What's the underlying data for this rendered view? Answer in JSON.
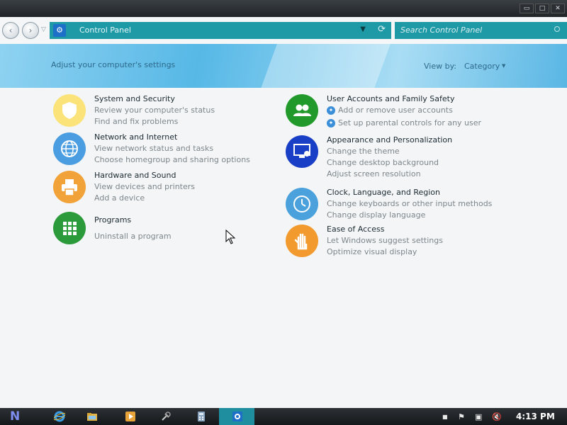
{
  "window": {
    "buttons": {
      "minimize": "▭",
      "maximize": "□",
      "close": "✕"
    }
  },
  "address": {
    "nav": {
      "back": "‹",
      "forward": "›",
      "dropdown": "▽"
    },
    "path": "Control Panel",
    "dropdown_glyph": "▼",
    "refresh_glyph": "⟳",
    "search_placeholder": "Search Control Panel"
  },
  "banner": {
    "heading": "Adjust your computer's settings",
    "view_by_label": "View by:",
    "view_by_value": "Category",
    "view_by_arrow": "▼"
  },
  "categories": [
    {
      "title": "System and Security",
      "links": [
        "Review your computer's status",
        "Find and fix problems"
      ],
      "icon": "shield-icon",
      "color": "#fbe37a"
    },
    {
      "title": "Network and Internet",
      "links": [
        "View network status and tasks",
        "Choose homegroup and sharing options"
      ],
      "icon": "globe-icon",
      "color": "#4a9de0"
    },
    {
      "title": "Hardware and Sound",
      "links": [
        "View devices and printers",
        "Add a device"
      ],
      "icon": "printer-icon",
      "color": "#f1a238"
    },
    {
      "title": "Programs",
      "links": [
        "Uninstall a program"
      ],
      "icon": "apps-grid-icon",
      "color": "#2a9a3a"
    },
    {
      "title": "User Accounts and Family Safety",
      "links": [
        "Add or remove user accounts",
        "Set up parental controls for any user"
      ],
      "icon": "users-icon",
      "color": "#219a2b"
    },
    {
      "title": "Appearance and Personalization",
      "links": [
        "Change the theme",
        "Change desktop background",
        "Adjust screen resolution"
      ],
      "icon": "monitor-icon",
      "color": "#1a3fc7"
    },
    {
      "title": "Clock, Language, and Region",
      "links": [
        "Change keyboards or other input methods",
        "Change display language"
      ],
      "icon": "clock-icon",
      "color": "#4aa1db"
    },
    {
      "title": "Ease of Access",
      "links": [
        "Let Windows suggest settings",
        "Optimize visual display"
      ],
      "icon": "hand-icon",
      "color": "#f29a2e"
    }
  ],
  "taskbar": {
    "start_glyph": "N",
    "clock": "4:13 PM",
    "tray": {
      "flag": "⚑",
      "network": "▣",
      "volume": "🔇"
    },
    "apps": [
      "internet-explorer-icon",
      "file-explorer-icon",
      "media-player-icon",
      "tools-icon",
      "calculator-icon",
      "control-panel-icon"
    ]
  },
  "colors": {
    "accent": "#1e9aa6",
    "banner": "#57b8e6",
    "taskbar": "#1d2125"
  }
}
